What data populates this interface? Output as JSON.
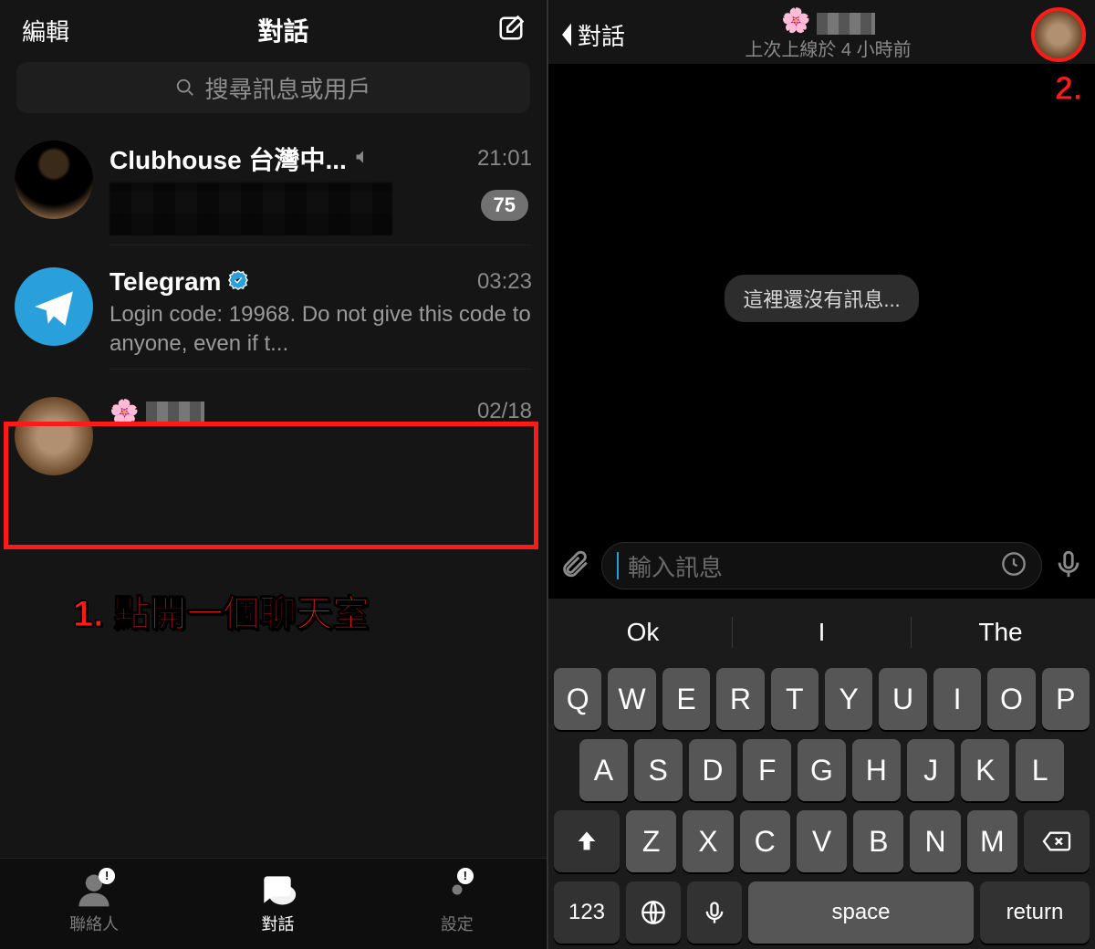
{
  "left": {
    "header": {
      "edit": "編輯",
      "title": "對話"
    },
    "search_placeholder": "搜尋訊息或用戶",
    "chats": [
      {
        "name": "Clubhouse 台灣中...",
        "time": "21:01",
        "badge": "75",
        "muted": true
      },
      {
        "name": "Telegram",
        "time": "03:23",
        "preview": "Login code: 19968. Do not give this code to anyone, even if t...",
        "verified": true
      },
      {
        "name_emoji": "🌸",
        "time": "02/18"
      }
    ],
    "annotation": "1. 點開一個聊天室",
    "tabs": {
      "contacts": "聯絡人",
      "chats": "對話",
      "settings": "設定"
    }
  },
  "right": {
    "back": "對話",
    "username_emoji": "🌸",
    "status": "上次上線於 4 小時前",
    "annotation": "2.",
    "empty_msg": "這裡還沒有訊息...",
    "input_placeholder": "輸入訊息",
    "suggestions": [
      "Ok",
      "I",
      "The"
    ],
    "keys_row1": [
      "Q",
      "W",
      "E",
      "R",
      "T",
      "Y",
      "U",
      "I",
      "O",
      "P"
    ],
    "keys_row2": [
      "A",
      "S",
      "D",
      "F",
      "G",
      "H",
      "J",
      "K",
      "L"
    ],
    "keys_row3": [
      "Z",
      "X",
      "C",
      "V",
      "B",
      "N",
      "M"
    ],
    "key_123": "123",
    "key_space": "space",
    "key_return": "return"
  }
}
